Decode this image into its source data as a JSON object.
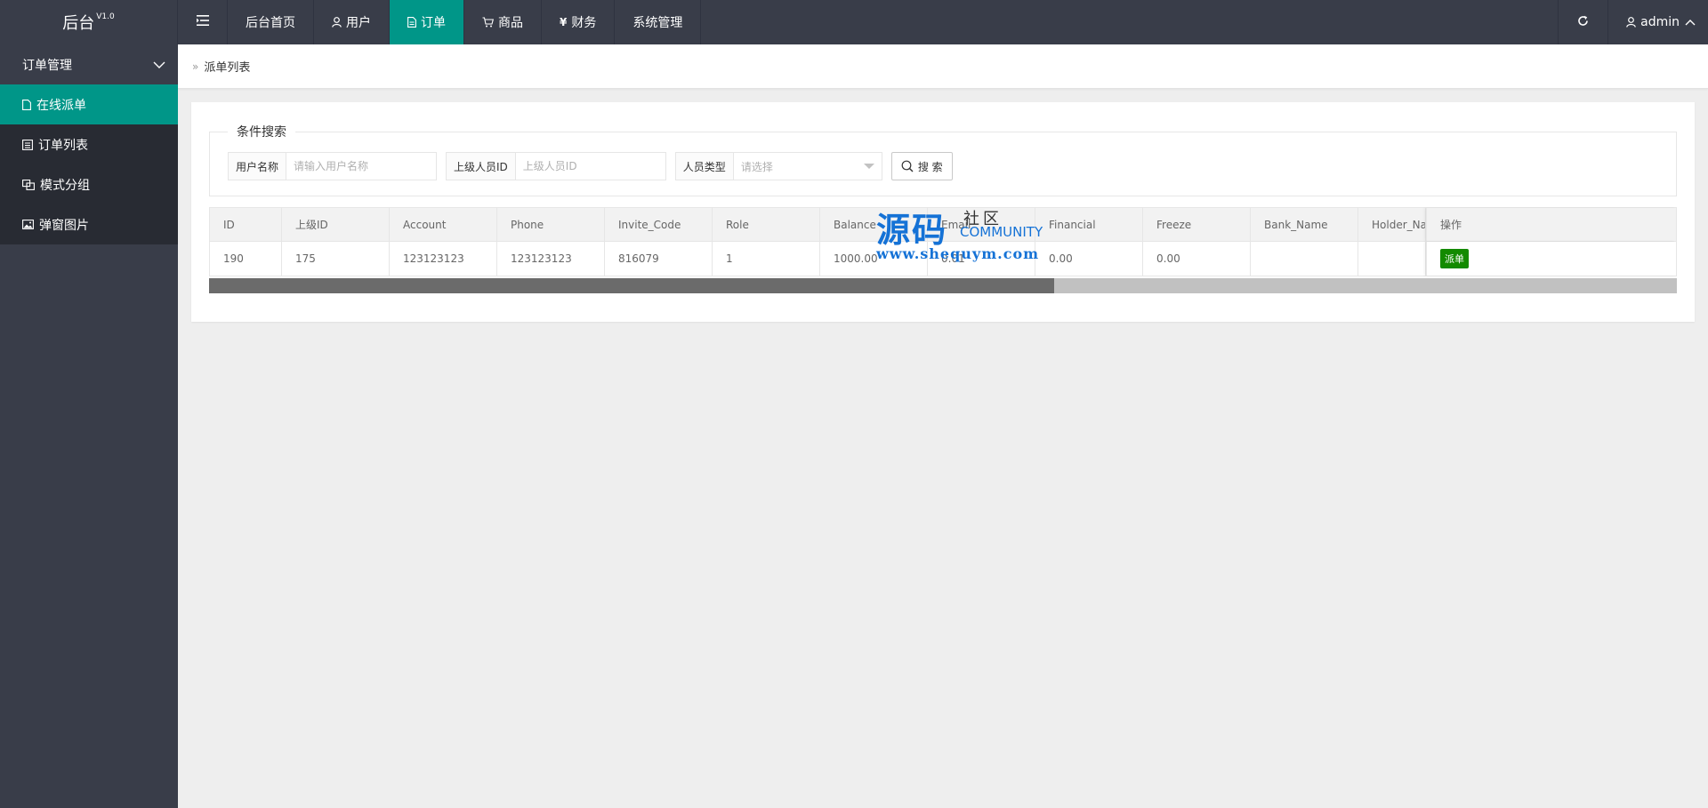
{
  "header": {
    "logo": "后台",
    "version": "V1.0",
    "nav": [
      {
        "label": "后台首页"
      },
      {
        "label": "用户"
      },
      {
        "label": "订单"
      },
      {
        "label": "商品"
      },
      {
        "label": "财务"
      },
      {
        "label": "系统管理"
      }
    ],
    "user": "admin"
  },
  "sidebar": {
    "group": "订单管理",
    "items": [
      {
        "label": "在线派单"
      },
      {
        "label": "订单列表"
      },
      {
        "label": "模式分组"
      },
      {
        "label": "弹窗图片"
      }
    ]
  },
  "breadcrumb": "派单列表",
  "search": {
    "legend": "条件搜索",
    "username_label": "用户名称",
    "username_placeholder": "请输入用户名称",
    "parent_label": "上级人员ID",
    "parent_placeholder": "上级人员ID",
    "type_label": "人员类型",
    "type_placeholder": "请选择",
    "button": "搜 索"
  },
  "table": {
    "headers": [
      "ID",
      "上级ID",
      "Account",
      "Phone",
      "Invite_Code",
      "Role",
      "Balance",
      "Email",
      "Financial",
      "Freeze",
      "Bank_Name",
      "Holder_Name",
      "操作"
    ],
    "rows": [
      [
        "190",
        "175",
        "123123123",
        "123123123",
        "816079",
        "1",
        "1000.00",
        "0.01",
        "0.00",
        "0.00",
        "",
        "",
        ""
      ]
    ],
    "action_label": "派单",
    "scroll_fraction": 0.576
  },
  "watermark": {
    "big": "源码",
    "small": "社区",
    "community": "COMMUNITY",
    "url": "www.shequym.com"
  },
  "colors": {
    "header_bg": "#393d49",
    "accent": "#009688",
    "action_green": "#138a00"
  }
}
